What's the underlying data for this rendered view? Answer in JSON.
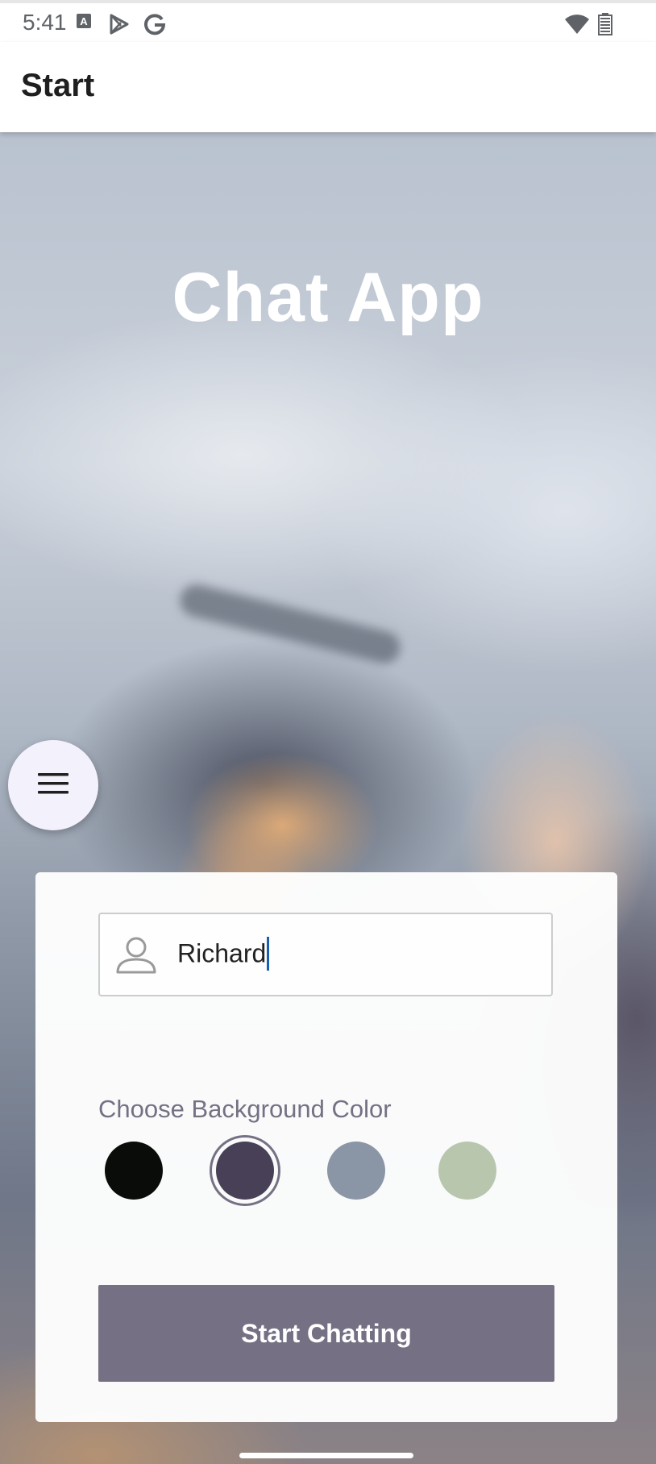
{
  "status_bar": {
    "time": "5:41",
    "left_icons": [
      "app-a-icon",
      "play-store-icon",
      "google-g-icon"
    ],
    "right_icons": [
      "wifi-icon",
      "battery-icon"
    ]
  },
  "app_bar": {
    "title": "Start"
  },
  "hero": {
    "title": "Chat App"
  },
  "fab": {
    "icon": "menu-icon"
  },
  "form": {
    "name_input": {
      "value": "Richard",
      "icon": "person-icon"
    },
    "color_label": "Choose Background Color",
    "colors": [
      {
        "hex": "#090C08",
        "selected": false
      },
      {
        "hex": "#474056",
        "selected": true
      },
      {
        "hex": "#8A95A5",
        "selected": false
      },
      {
        "hex": "#B9C6AE",
        "selected": false
      }
    ],
    "start_button_label": "Start Chatting",
    "button_color": "#757083"
  }
}
